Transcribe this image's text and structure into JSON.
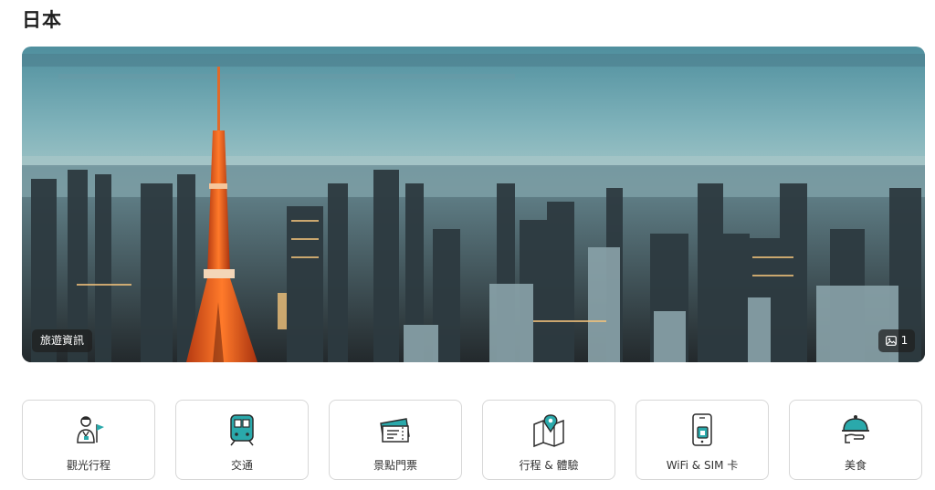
{
  "page": {
    "title": "日本"
  },
  "hero": {
    "tag_label": "旅遊資訊",
    "photo_count": "1",
    "image_icon": "image-icon"
  },
  "categories": [
    {
      "label": "觀光行程",
      "icon": "tour-guide-icon"
    },
    {
      "label": "交通",
      "icon": "train-icon"
    },
    {
      "label": "景點門票",
      "icon": "ticket-icon"
    },
    {
      "label": "行程 & 體驗",
      "icon": "map-pin-icon"
    },
    {
      "label": "WiFi & SIM 卡",
      "icon": "phone-sim-icon"
    },
    {
      "label": "美食",
      "icon": "food-cloche-icon"
    }
  ],
  "colors": {
    "icon_teal": "#2aa9ab",
    "icon_dark": "#2b2b2b",
    "border": "#d7d7d7"
  }
}
